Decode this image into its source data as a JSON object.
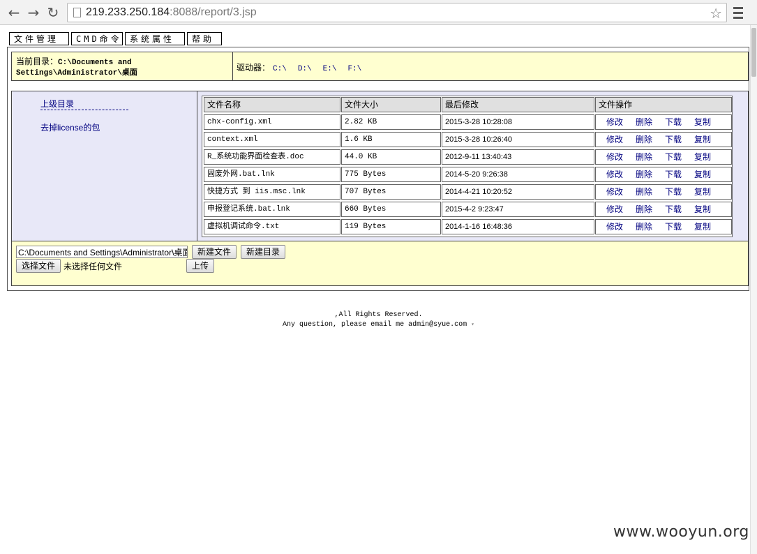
{
  "browser": {
    "url_host": "219.233.250.184",
    "url_path": ":8088/report/3.jsp"
  },
  "tabs": [
    {
      "label": "文件管理"
    },
    {
      "label": "CMD命令"
    },
    {
      "label": "系统属性"
    },
    {
      "label": "帮助"
    }
  ],
  "info": {
    "current_dir_label": "当前目录：",
    "current_dir_path_1": "C:\\Documents and",
    "current_dir_path_2": "Settings\\Administrator\\桌面",
    "drives_label": "驱动器：",
    "drives": [
      "C:\\",
      "D:\\",
      "E:\\",
      "F:\\"
    ]
  },
  "sidebar": {
    "parent_dir": "上级目录",
    "dashes": "- - - - - - - - - - - -",
    "link": "去掉license的包"
  },
  "table": {
    "headers": [
      "文件名称",
      "文件大小",
      "最后修改",
      "文件操作"
    ],
    "ops": [
      "修改",
      "删除",
      "下载",
      "复制"
    ],
    "rows": [
      {
        "name": "chx-config.xml",
        "size": "2.82 KB",
        "date": "2015-3-28 10:28:08"
      },
      {
        "name": "context.xml",
        "size": "1.6 KB",
        "date": "2015-3-28 10:26:40"
      },
      {
        "name": "R_系统功能界面检查表.doc",
        "size": "44.0 KB",
        "date": "2012-9-11 13:40:43"
      },
      {
        "name": "固废外网.bat.lnk",
        "size": "775 Bytes",
        "date": "2014-5-20 9:26:38"
      },
      {
        "name": "快捷方式 到 iis.msc.lnk",
        "size": "707 Bytes",
        "date": "2014-4-21 10:20:52"
      },
      {
        "name": "申报登记系统.bat.lnk",
        "size": "660 Bytes",
        "date": "2015-4-2 9:23:47"
      },
      {
        "name": "虚拟机调试命令.txt",
        "size": "119 Bytes",
        "date": "2014-1-16 16:48:36"
      }
    ]
  },
  "bottom": {
    "path_value": "C:\\Documents and Settings\\Administrator\\桌面",
    "new_file": "新建文件",
    "new_dir": "新建目录",
    "choose_file": "选择文件",
    "no_file": "未选择任何文件",
    "upload": "上传"
  },
  "footer": {
    "rights": ",All Rights Reserved.",
    "contact": "Any question, please email me admin@syue.com"
  },
  "watermark": "www.wooyun.org"
}
